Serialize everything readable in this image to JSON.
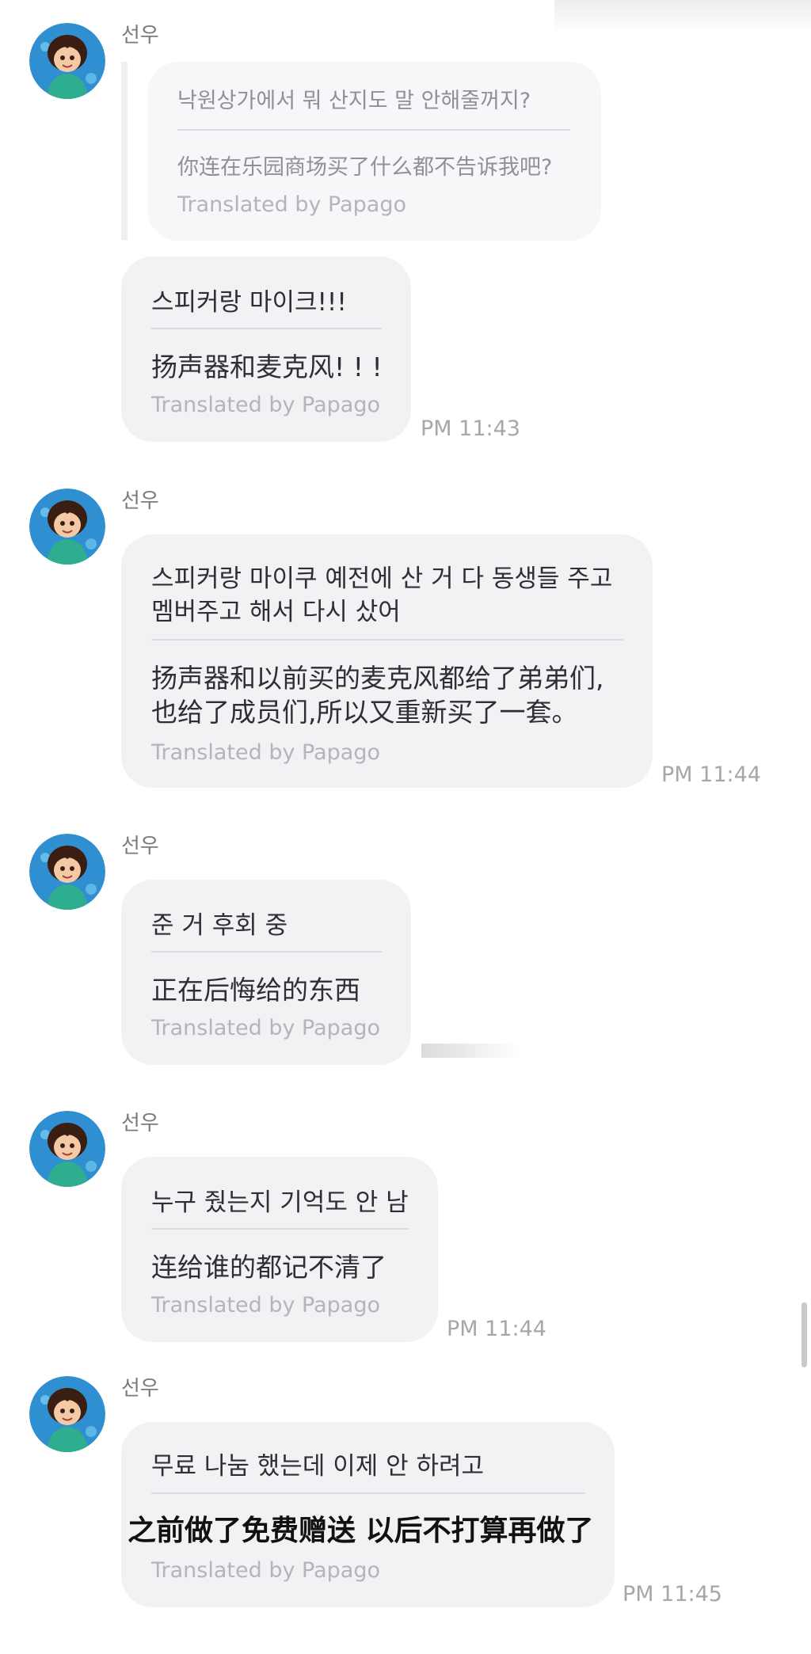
{
  "conversation": {
    "messages": [
      {
        "sender": "선우",
        "korean": "낙원상가에서 뭐 산지도 말 안해줄꺼지?",
        "chinese": "你连在乐园商场买了什么都不告诉我吧?",
        "credit": "Translated by Papago",
        "time": ""
      },
      {
        "sender": "",
        "korean": "스피커랑 마이크!!!",
        "chinese": "扬声器和麦克风! ! !",
        "credit": "Translated by Papago",
        "time": "PM 11:43"
      },
      {
        "sender": "선우",
        "korean_lines": [
          "스피커랑 마이쿠 예전에 산 거 다 동생들 주고",
          "멤버주고 해서 다시 샀어"
        ],
        "chinese_lines": [
          "扬声器和以前买的麦克风都给了弟弟们,",
          "也给了成员们,所以又重新买了一套。"
        ],
        "credit": "Translated by Papago",
        "time": "PM 11:44"
      },
      {
        "sender": "선우",
        "korean": "준 거 후회 중",
        "chinese": "正在后悔给的东西",
        "credit": "Translated by Papago",
        "time": ""
      },
      {
        "sender": "선우",
        "korean": "누구 줬는지 기억도 안 남",
        "chinese": "连给谁的都记不清了",
        "credit": "Translated by Papago",
        "time": "PM 11:44"
      },
      {
        "sender": "선우",
        "korean": "무료 나눔 했는데 이제 안 하려고",
        "chinese": "之前做了免费赠送 以后不打算再做了",
        "credit": "Translated by Papago",
        "time": "PM 11:45"
      }
    ]
  },
  "avatar": {
    "icon": "cartoon-girl-avatar",
    "colors": {
      "background": "#2f8fd0",
      "hair": "#3a1e12",
      "skin": "#f4c9a6",
      "shirt": "#2fae8f"
    }
  },
  "colors": {
    "bubble": "#f2f2f5",
    "reply_bubble": "#f7f7f9",
    "text": "#2f2f33",
    "muted": "#a6a6ac"
  }
}
